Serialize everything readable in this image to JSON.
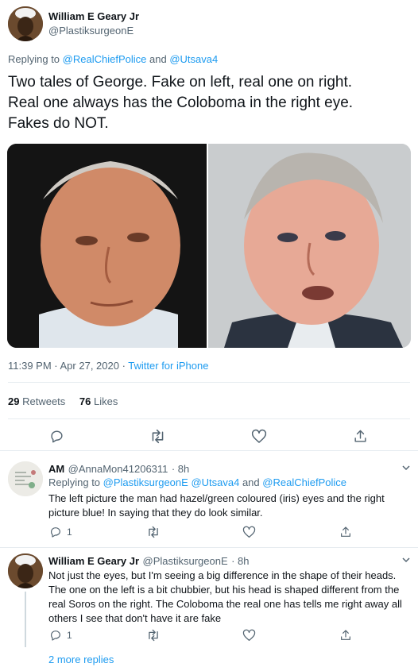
{
  "main_tweet": {
    "author_name": "William E Geary Jr",
    "author_handle": "@PlastiksurgeonE",
    "replying_prefix": "Replying to",
    "replying_to_1": "@RealChiefPolice",
    "replying_and": "and",
    "replying_to_2": "@Utsava4",
    "text_line_1": "Two tales of George. Fake on left, real one on right.",
    "text_line_2": "Real one always has the Coloboma in the right eye.",
    "text_line_3": "Fakes do NOT.",
    "timestamp": "11:39 PM · Apr 27, 2020 ·",
    "source": "Twitter for iPhone",
    "retweets_count": "29",
    "retweets_label": "Retweets",
    "likes_count": "76",
    "likes_label": "Likes"
  },
  "reply_1": {
    "author_name": "AM",
    "author_handle": "@AnnaMon41206311",
    "time": "· 8h",
    "replying_prefix": "Replying to",
    "replying_to_1": "@PlastiksurgeonE",
    "replying_to_2": "@Utsava4",
    "replying_and": "and",
    "replying_to_3": "@RealChiefPolice",
    "text": "The left picture the man had hazel/green coloured (iris) eyes and the right picture blue! In saying that they do look similar.",
    "reply_count": "1"
  },
  "reply_2": {
    "author_name": "William E Geary Jr",
    "author_handle": "@PlastiksurgeonE",
    "time": "· 8h",
    "text": "Not just the eyes, but I'm seeing a big difference in the shape of their heads. The one on the left is a bit chubbier, but his head is shaped different from the real Soros on the right. The Coloboma the real one has tells me right away all others I see that don't have it are fake",
    "reply_count": "1"
  },
  "more_replies": "2 more replies",
  "colors": {
    "accent": "#1d9bf0",
    "text": "#0f1419",
    "muted": "#536471",
    "divider": "#e6ecf0"
  }
}
